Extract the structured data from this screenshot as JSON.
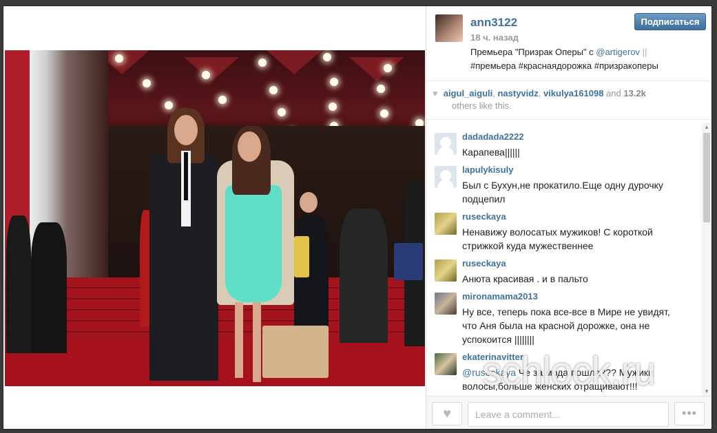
{
  "post": {
    "username": "ann3122",
    "time": "18 ч. назад",
    "caption_text": "Премьера \"Призрак Оперы\" с ",
    "caption_mention": "@artigerov",
    "caption_sep": " ||",
    "caption_tags": "#премьера #краснаядорожка #призракоперы",
    "follow_label": "Подписаться"
  },
  "likes": {
    "users": [
      "aigul_aiguli",
      "nastyvidz",
      "vikulya161098"
    ],
    "and": "and",
    "count": "13.2k",
    "tail": "others like this."
  },
  "comments": [
    {
      "user": "dadadada2222",
      "text": "Карапева||||||",
      "avatar": "default-avatar"
    },
    {
      "user": "lapulykisuly",
      "text": "Был с Бухун,не прокатило.Еще одну дурочку подцепил",
      "avatar": "default-avatar"
    },
    {
      "user": "ruseckaya",
      "text": "Ненавижу волосатых мужиков! С короткой стрижкой куда мужественнее",
      "avatar": "photo-avatar"
    },
    {
      "user": "ruseckaya",
      "text": "Анюта красивая . и в пальто",
      "avatar": "photo-avatar"
    },
    {
      "user": "mironamama2013",
      "text": "Ну все, теперь пока все-все в Мире не увидят, что Аня была на красной дорожке, она не успокоится ||||||||",
      "avatar": "photo-avatar"
    },
    {
      "user": "ekaterinavitter",
      "mention": "@ruseckaya",
      "text": " Че за мода пошла??? Мужики волосы,больше женских отращивают!!! Фуууууу.... Этому мужику не идёт!!!!стремновато",
      "avatar": "photo-avatar"
    }
  ],
  "composer": {
    "placeholder": "Leave a comment...",
    "more_label": "•••"
  },
  "watermark": "schlock.ru"
}
